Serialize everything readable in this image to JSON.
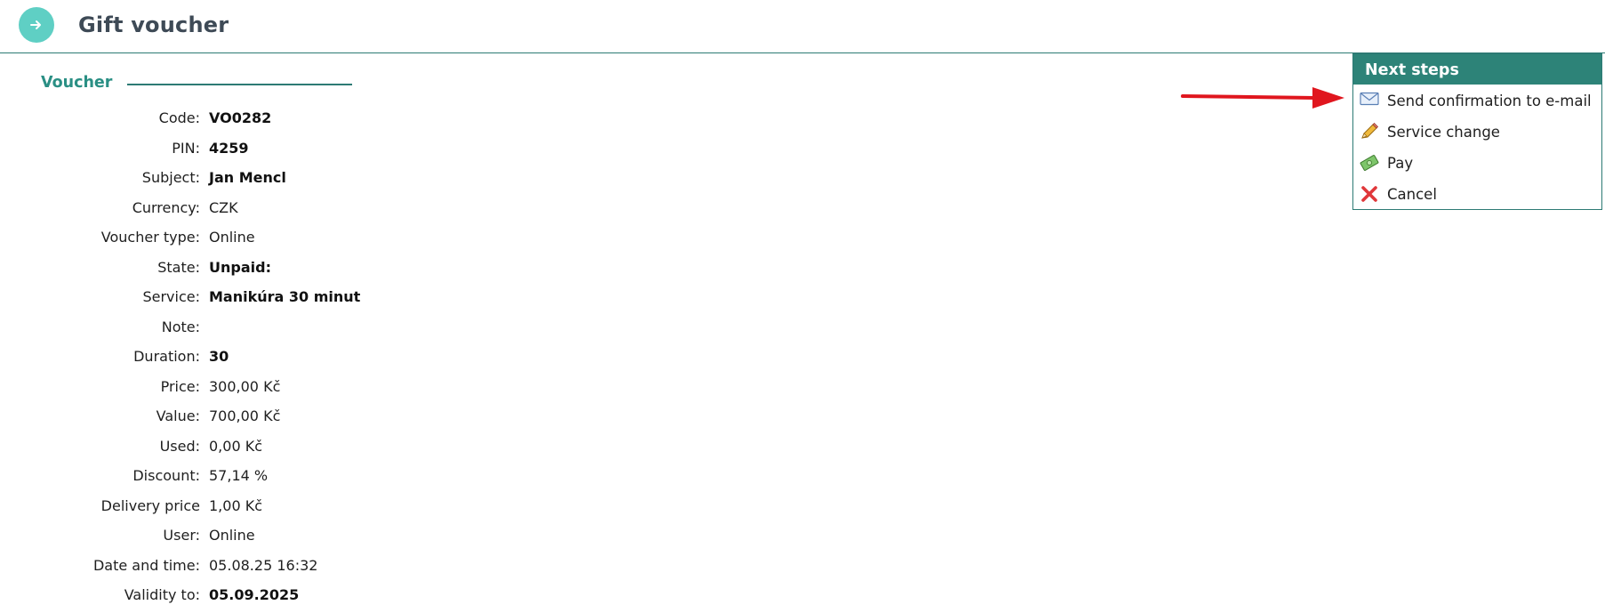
{
  "header": {
    "title": "Gift voucher",
    "icon": "arrow-right-circle-icon",
    "accent": "#5fcfc4"
  },
  "section": {
    "title": "Voucher"
  },
  "details": [
    {
      "label": "Code:",
      "value": "VO0282",
      "bold": true
    },
    {
      "label": "PIN:",
      "value": "4259",
      "bold": true
    },
    {
      "label": "Subject:",
      "value": "Jan Mencl",
      "bold": true
    },
    {
      "label": "Currency:",
      "value": "CZK",
      "bold": false
    },
    {
      "label": "Voucher type:",
      "value": "Online",
      "bold": false
    },
    {
      "label": "State:",
      "value": "Unpaid:",
      "bold": true
    },
    {
      "label": "Service:",
      "value": "Manikúra 30 minut",
      "bold": true
    },
    {
      "label": "Note:",
      "value": "",
      "bold": false
    },
    {
      "label": "Duration:",
      "value": "30",
      "bold": true
    },
    {
      "label": "Price:",
      "value": "300,00 Kč",
      "bold": false
    },
    {
      "label": "Value:",
      "value": "700,00 Kč",
      "bold": false
    },
    {
      "label": "Used:",
      "value": "0,00 Kč",
      "bold": false
    },
    {
      "label": "Discount:",
      "value": "57,14 %",
      "bold": false
    },
    {
      "label": "Delivery price",
      "value": "1,00 Kč",
      "bold": false
    },
    {
      "label": "User:",
      "value": "Online",
      "bold": false
    },
    {
      "label": "Date and time:",
      "value": "05.08.25 16:32",
      "bold": false
    },
    {
      "label": "Validity to:",
      "value": "05.09.2025",
      "bold": true
    }
  ],
  "next_steps": {
    "title": "Next steps",
    "items": [
      {
        "label": "Send confirmation to e-mail",
        "icon": "envelope-icon"
      },
      {
        "label": "Service change",
        "icon": "pencil-icon"
      },
      {
        "label": "Pay",
        "icon": "money-icon"
      },
      {
        "label": "Cancel",
        "icon": "cancel-x-icon"
      }
    ]
  },
  "annotation": {
    "arrow_color": "#e0161e"
  }
}
